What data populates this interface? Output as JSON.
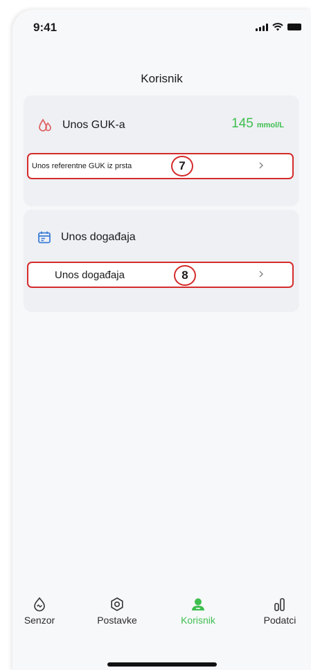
{
  "status_bar": {
    "time": "9:41"
  },
  "page": {
    "title": "Korisnik"
  },
  "glucose_card": {
    "title": "Unos GUK-a",
    "value": "145",
    "unit": "mmol/L",
    "row_label": "Unos referentne GUK iz prsta",
    "badge": "7",
    "row_icon": "chevron-right-icon",
    "icon": "blood-drop-icon"
  },
  "event_card": {
    "title": "Unos događaja",
    "row_label": "Unos događaja",
    "badge": "8",
    "row_icon": "chevron-right-icon",
    "icon": "calendar-icon"
  },
  "tabbar": {
    "tabs": [
      {
        "label": "Senzor",
        "icon": "sensor-icon",
        "active": false
      },
      {
        "label": "Postavke",
        "icon": "settings-icon",
        "active": false
      },
      {
        "label": "Korisnik",
        "icon": "user-icon",
        "active": true
      },
      {
        "label": "Podatci",
        "icon": "bar-chart-icon",
        "active": false
      }
    ]
  },
  "colors": {
    "accent_green": "#3fbe4f",
    "highlight_red": "#d42a2a",
    "card_bg": "#eef0f4",
    "drop_icon": "#e06666",
    "calendar_icon": "#3b7dd8"
  }
}
